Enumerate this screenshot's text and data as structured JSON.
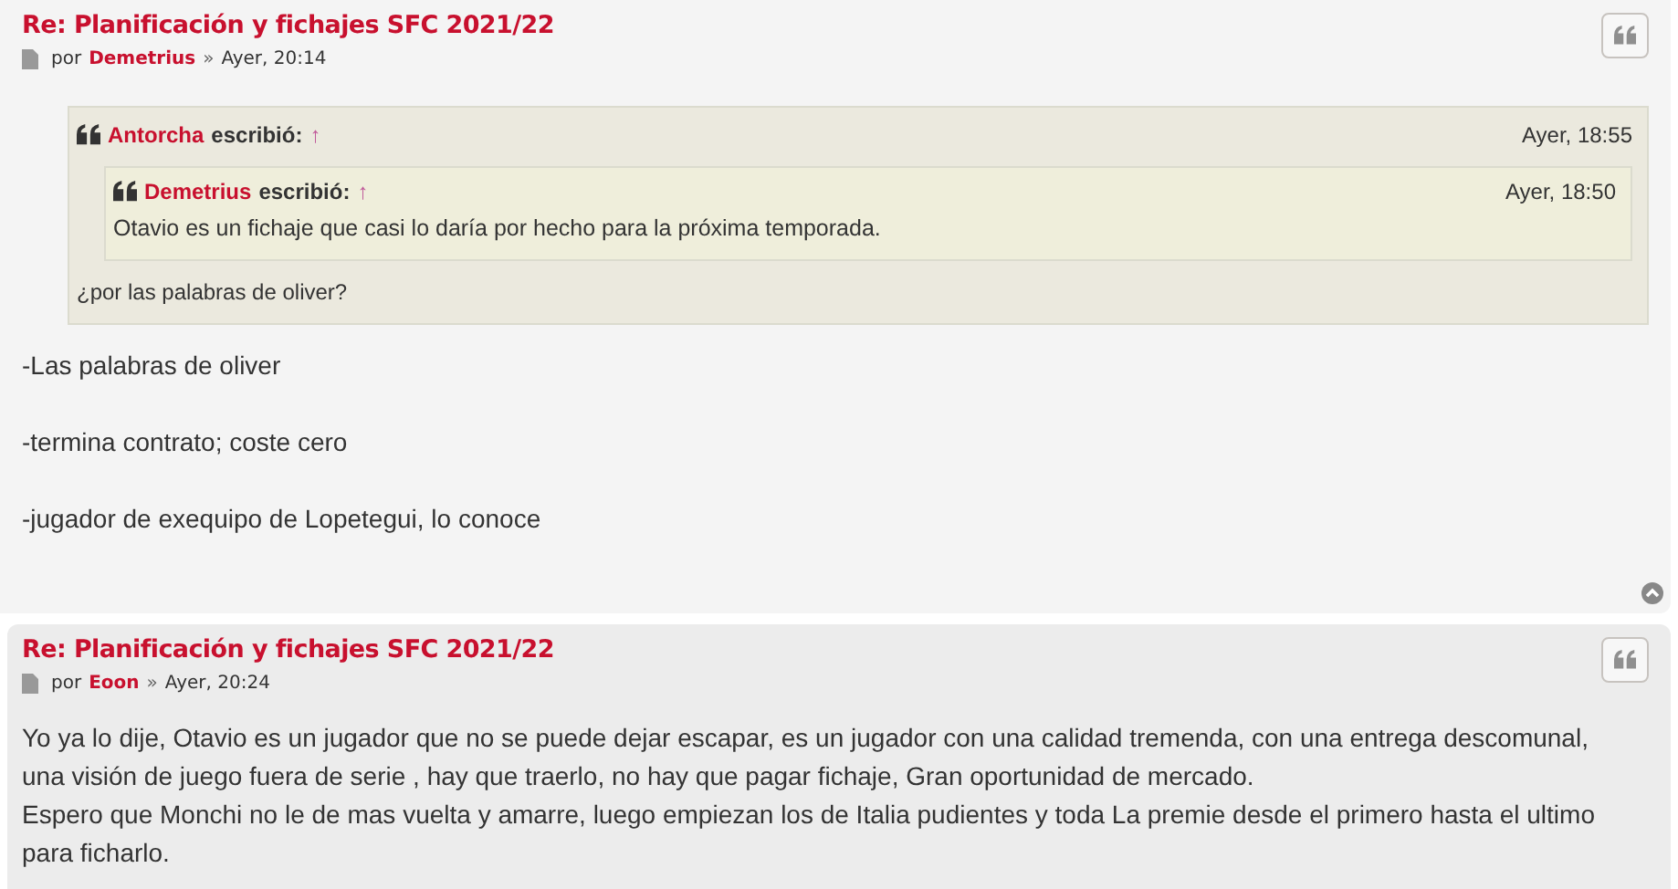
{
  "posts": [
    {
      "title": "Re: Planificación y fichajes SFC 2021/22",
      "by": "por",
      "author": "Demetrius",
      "sep": "»",
      "time": "Ayer, 20:14",
      "back_to_top": true,
      "quote": {
        "author": "Antorcha",
        "wrote": "escribió:",
        "arrow": "↑",
        "time": "Ayer, 18:55",
        "quote": {
          "author": "Demetrius",
          "wrote": "escribió:",
          "arrow": "↑",
          "time": "Ayer, 18:50",
          "paragraphs": [
            "Otavio es un fichaje que casi lo daría por hecho para la próxima temporada."
          ]
        },
        "paragraphs": [
          "¿por las palabras de oliver?"
        ]
      },
      "paragraphs": [
        "-Las palabras de oliver",
        "-termina contrato; coste cero",
        "-jugador de exequipo de Lopetegui, lo conoce"
      ]
    },
    {
      "title": "Re: Planificación y fichajes SFC 2021/22",
      "by": "por",
      "author": "Eoon",
      "sep": "»",
      "time": "Ayer, 20:24",
      "back_to_top": false,
      "paragraphs": [
        "Yo ya lo dije, Otavio es un jugador que no se puede dejar escapar, es un jugador con una calidad tremenda, con una entrega descomunal, una visión de juego fuera de serie , hay que traerlo, no hay que pagar fichaje, Gran oportunidad de mercado.\nEspero que Monchi no le de mas vuelta y amarre, luego empiezan los de Italia pudientes y toda La premie desde el primero hasta el ultimo para ficharlo."
      ]
    }
  ]
}
